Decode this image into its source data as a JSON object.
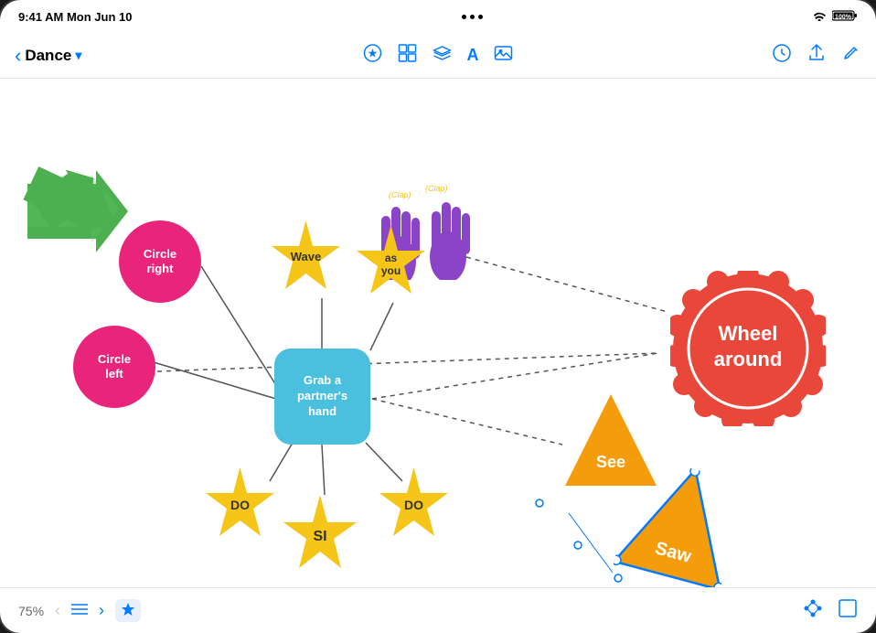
{
  "status_bar": {
    "time": "9:41 AM  Mon Jun 10",
    "wifi": "wifi",
    "battery": "100%"
  },
  "toolbar": {
    "back_label": "Dance",
    "chevron_down": "▾",
    "back_chevron": "‹",
    "icons": {
      "shape": "⊙",
      "grid": "⊞",
      "layers": "⧠",
      "text": "A",
      "image": "⊡",
      "clock": "⏱",
      "share": "↑",
      "edit": "✎"
    }
  },
  "canvas": {
    "nodes": {
      "circle_right": "Circle\nright",
      "circle_left": "Circle\nleft",
      "center": "Grab a\npartner's\nhand",
      "wave": "Wave",
      "as_you": "as\nyou",
      "do_left": "DO",
      "si": "SI",
      "do_right": "DO",
      "wheel_around": "Wheel\naround",
      "see": "See",
      "saw": "Saw"
    }
  },
  "bottom_bar": {
    "zoom": "75%",
    "prev_icon": "‹",
    "list_icon": "≡",
    "next_icon": "›",
    "star_icon": "★"
  },
  "colors": {
    "pink": "#e8257a",
    "blue": "#4bbfde",
    "gold": "#f5c518",
    "red": "#e8473a",
    "orange": "#f59c0a",
    "green": "#4caf50",
    "purple": "#8B44C8",
    "accent": "#007AFF"
  }
}
